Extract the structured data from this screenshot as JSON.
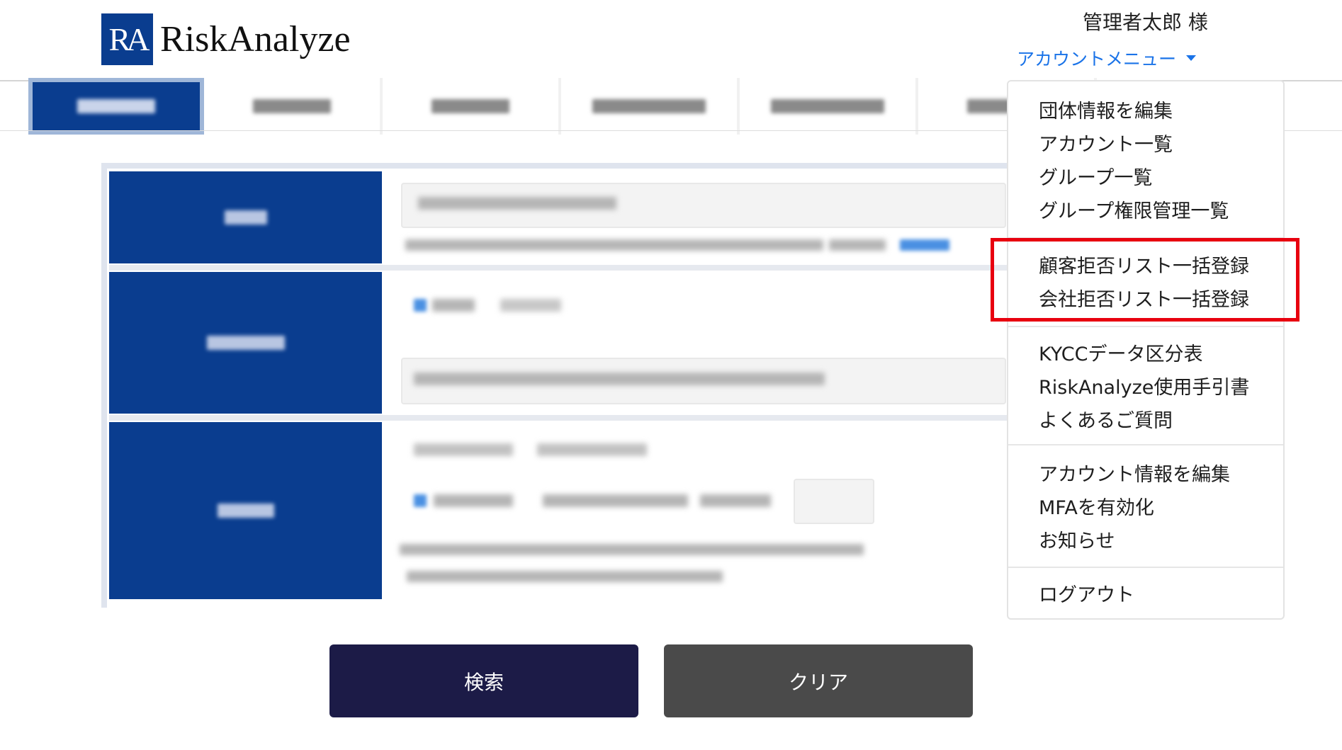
{
  "header": {
    "logo_mark": "RA",
    "logo_text": "RiskAnalyze",
    "user_name": "管理者太郎 様",
    "account_menu_label": "アカウントメニュー"
  },
  "account_menu": {
    "groups": [
      [
        "団体情報を編集",
        "アカウント一覧",
        "グループ一覧",
        "グループ権限管理一覧"
      ],
      [
        "顧客拒否リスト一括登録",
        "会社拒否リスト一括登録"
      ],
      [
        "KYCCデータ区分表",
        "RiskAnalyze使用手引書",
        "よくあるご質問"
      ],
      [
        "アカウント情報を編集",
        "MFAを有効化",
        "お知らせ"
      ],
      [
        "ログアウト"
      ]
    ]
  },
  "buttons": {
    "search": "検索",
    "clear": "クリア"
  },
  "colors": {
    "brand": "#0a3d8f",
    "link": "#1a73e8",
    "search_button": "#1c1b47",
    "clear_button": "#4a4a4a",
    "highlight": "#e8000f"
  }
}
